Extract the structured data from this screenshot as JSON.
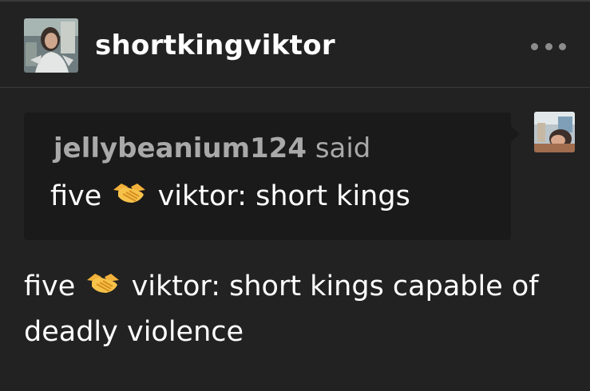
{
  "post": {
    "blog_name": "shortkingviktor",
    "more_icon": "more-horizontal-icon",
    "avatar_icon": "blog-avatar-photo",
    "quote": {
      "author": "jellybeanium124",
      "said": "said",
      "text_before": "five",
      "emoji": "handshake-emoji",
      "text_after": "viktor: short kings",
      "avatar_icon": "quoted-user-avatar-photo"
    },
    "body": {
      "text_before": "five",
      "emoji": "handshake-emoji",
      "text_after": "viktor: short kings capable of deadly violence"
    }
  },
  "colors": {
    "background": "#222222",
    "quote_background": "#1a1a1a",
    "muted_text": "#a9a9a9",
    "emoji_yellow": "#f5b83d"
  }
}
